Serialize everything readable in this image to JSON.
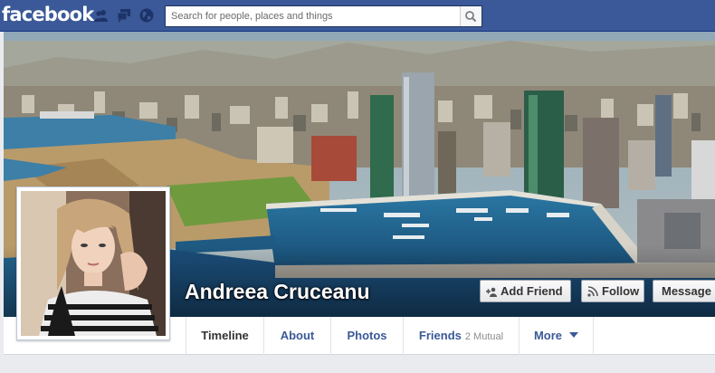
{
  "topbar": {
    "logo": "facebook",
    "search_placeholder": "Search for people, places and things",
    "icons": [
      "friend-requests-icon",
      "messages-icon",
      "notifications-globe-icon",
      "search-icon"
    ]
  },
  "profile": {
    "name": "Andreea Cruceanu"
  },
  "actions": {
    "add_friend": "Add Friend",
    "follow": "Follow",
    "message": "Message"
  },
  "tabs": {
    "timeline": "Timeline",
    "about": "About",
    "photos": "Photos",
    "friends": "Friends",
    "friends_mutual": "2 Mutual",
    "more": "More"
  },
  "colors": {
    "brand": "#3b5998",
    "link": "#3b5998"
  }
}
